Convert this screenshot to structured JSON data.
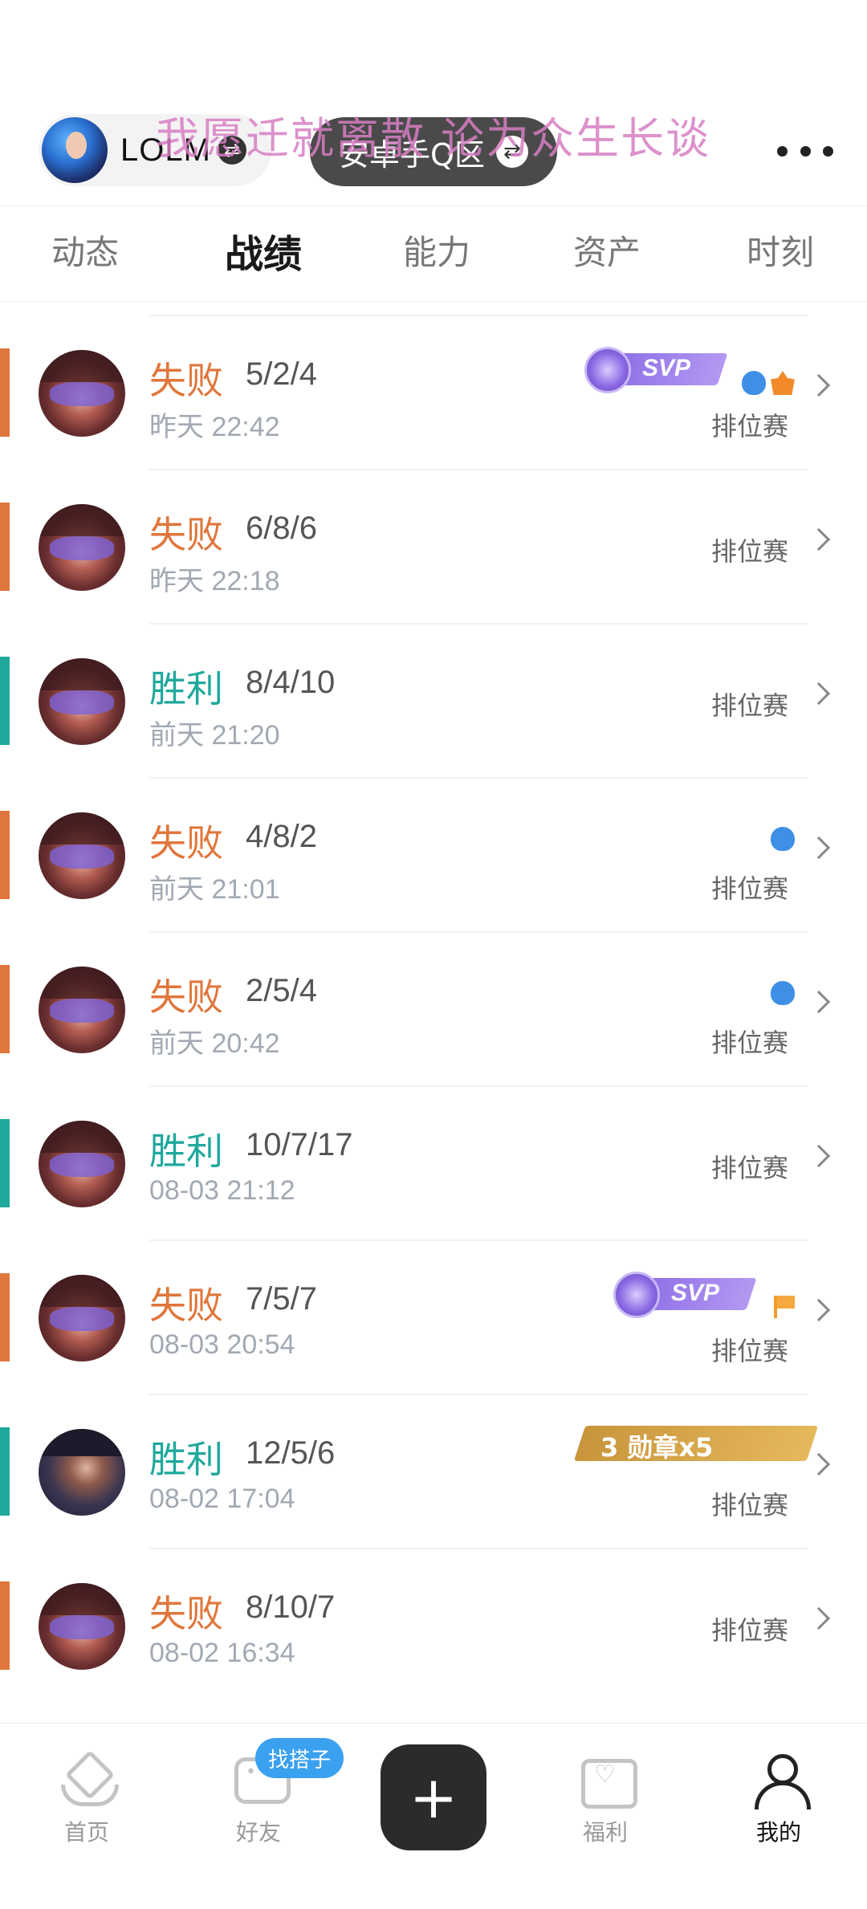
{
  "header": {
    "game_name": "LOLM",
    "server_name": "安卓手Q区",
    "watermark": "我愿迁就离散 论为众生长谈",
    "swap_icon": "swap-arrows-icon",
    "more_icon": "more-dots-icon"
  },
  "tabs": [
    {
      "label": "动态"
    },
    {
      "label": "战绩"
    },
    {
      "label": "能力"
    },
    {
      "label": "资产"
    },
    {
      "label": "时刻"
    }
  ],
  "active_tab": "战绩",
  "colors": {
    "lose": "#e0763b",
    "win": "#1fa89c",
    "svp": "#9a7ce8",
    "medal": "#d7a34a"
  },
  "matches": [
    {
      "result": "失败",
      "kda": "5/2/4",
      "time": "昨天 22:42",
      "mode": "排位赛",
      "badge": "SVP",
      "icons": [
        "blue-flame-icon",
        "orange-flame-icon"
      ]
    },
    {
      "result": "失败",
      "kda": "6/8/6",
      "time": "昨天 22:18",
      "mode": "排位赛"
    },
    {
      "result": "胜利",
      "kda": "8/4/10",
      "time": "前天 21:20",
      "mode": "排位赛"
    },
    {
      "result": "失败",
      "kda": "4/8/2",
      "time": "前天 21:01",
      "mode": "排位赛",
      "icons": [
        "blue-flame-icon"
      ]
    },
    {
      "result": "失败",
      "kda": "2/5/4",
      "time": "前天 20:42",
      "mode": "排位赛",
      "icons": [
        "blue-flame-icon"
      ]
    },
    {
      "result": "胜利",
      "kda": "10/7/17",
      "time": "08-03 21:12",
      "mode": "排位赛"
    },
    {
      "result": "失败",
      "kda": "7/5/7",
      "time": "08-03 20:54",
      "mode": "排位赛",
      "badge": "SVP",
      "icons": [
        "orange-flag-icon"
      ]
    },
    {
      "result": "胜利",
      "kda": "12/5/6",
      "time": "08-02 17:04",
      "mode": "排位赛",
      "medal_badge": "3 勋章x5"
    },
    {
      "result": "失败",
      "kda": "8/10/7",
      "time": "08-02 16:34",
      "mode": "排位赛"
    }
  ],
  "bottom_nav": [
    {
      "label": "首页",
      "icon": "home-icon"
    },
    {
      "label": "好友",
      "icon": "chat-icon",
      "badge": "找搭子"
    },
    {
      "label": "",
      "icon": "plus-icon"
    },
    {
      "label": "福利",
      "icon": "gift-icon"
    },
    {
      "label": "我的",
      "icon": "user-icon"
    }
  ]
}
